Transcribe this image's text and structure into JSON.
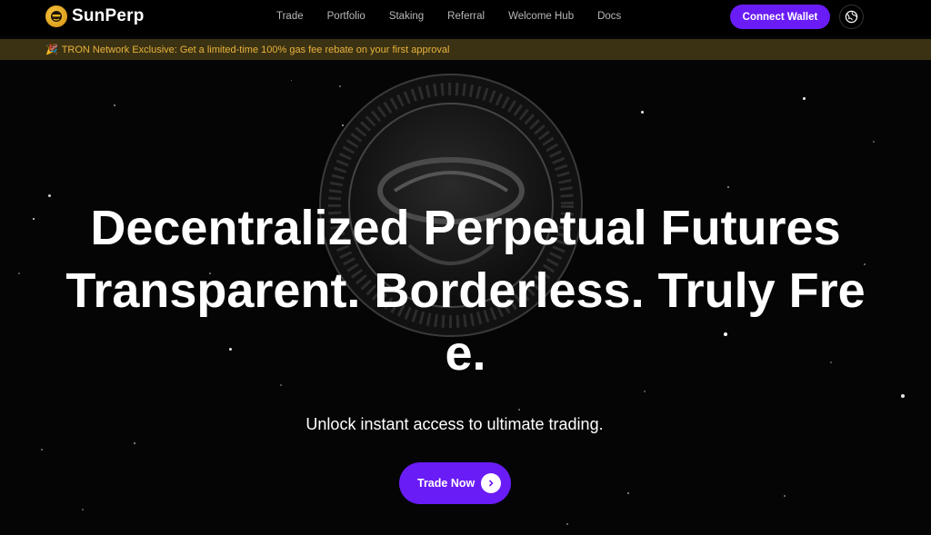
{
  "brand": {
    "name": "SunPerp",
    "logo_icon": "sun-face-logo-icon"
  },
  "nav": {
    "items": [
      {
        "label": "Trade"
      },
      {
        "label": "Portfolio"
      },
      {
        "label": "Staking"
      },
      {
        "label": "Referral"
      },
      {
        "label": "Welcome Hub"
      },
      {
        "label": "Docs"
      }
    ]
  },
  "header": {
    "connect_label": "Connect Wallet",
    "language_icon": "globe-icon"
  },
  "announcement": {
    "icon": "party-popper-icon",
    "text": "TRON Network Exclusive: Get a limited-time 100% gas fee rebate on your first approval"
  },
  "hero": {
    "title_line1": "Decentralized Perpetual Futures",
    "title_line2": "Transparent. Borderless. Truly Fre",
    "title_line3": "e.",
    "subtitle": "Unlock instant access to ultimate trading.",
    "cta_label": "Trade Now",
    "cta_icon": "chevron-right-icon"
  },
  "colors": {
    "accent": "#6a1cf6",
    "banner_bg": "#3b3213",
    "banner_text": "#e8b23c",
    "logo": "#f2b51f"
  }
}
